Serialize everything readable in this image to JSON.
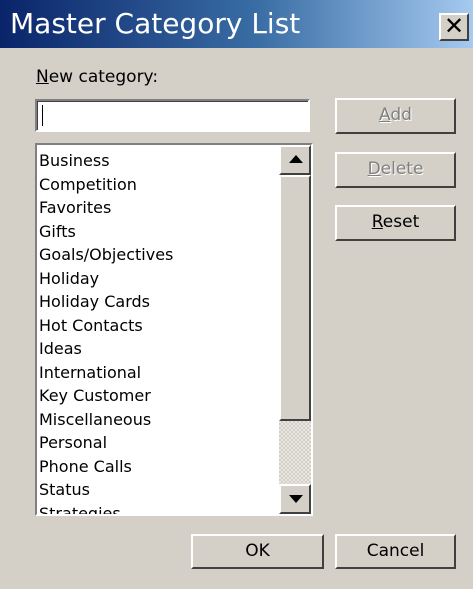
{
  "window": {
    "title": "Master Category List",
    "close_glyph": "✕"
  },
  "new_category": {
    "label_underlined": "N",
    "label_rest": "ew category:",
    "value": "",
    "placeholder": ""
  },
  "categories": [
    "Business",
    "Competition",
    "Favorites",
    "Gifts",
    "Goals/Objectives",
    "Holiday",
    "Holiday Cards",
    "Hot Contacts",
    "Ideas",
    "International",
    "Key Customer",
    "Miscellaneous",
    "Personal",
    "Phone Calls",
    "Status",
    "Strategies"
  ],
  "buttons": {
    "add": {
      "underlined": "A",
      "rest": "dd",
      "enabled": false
    },
    "delete": {
      "underlined": "D",
      "rest": "elete",
      "enabled": false
    },
    "reset": {
      "underlined": "R",
      "rest": "eset",
      "enabled": true
    },
    "ok": "OK",
    "cancel": "Cancel"
  },
  "icons": {
    "close": "close-icon",
    "scroll_up": "arrow-up-icon",
    "scroll_down": "arrow-down-icon"
  },
  "colors": {
    "dialog_bg": "#d4d0c8",
    "title_gradient_start": "#0a246a",
    "title_gradient_end": "#a6caf0",
    "disabled_text": "#808080"
  }
}
